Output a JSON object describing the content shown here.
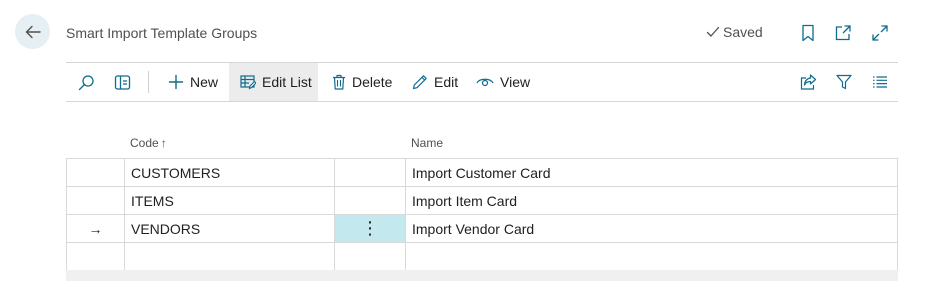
{
  "header": {
    "title": "Smart Import Template Groups",
    "status": "Saved"
  },
  "toolbar": {
    "new_label": "New",
    "edit_list_label": "Edit List",
    "delete_label": "Delete",
    "edit_label": "Edit",
    "view_label": "View"
  },
  "grid": {
    "columns": {
      "code": "Code",
      "sort_indicator": "↑",
      "name": "Name"
    },
    "rows": [
      {
        "indicator": "",
        "code": "CUSTOMERS",
        "action": "",
        "name": "Import Customer Card"
      },
      {
        "indicator": "",
        "code": "ITEMS",
        "action": "",
        "name": "Import Item Card"
      },
      {
        "indicator": "→",
        "code": "VENDORS",
        "action": "⋮",
        "name": "Import Vendor Card"
      },
      {
        "indicator": "",
        "code": "",
        "action": "",
        "name": ""
      }
    ],
    "selected_row_color": "#c3e9ee"
  },
  "colors": {
    "accent": "#0f6b8f",
    "back_button_bg": "#e5eff4"
  }
}
